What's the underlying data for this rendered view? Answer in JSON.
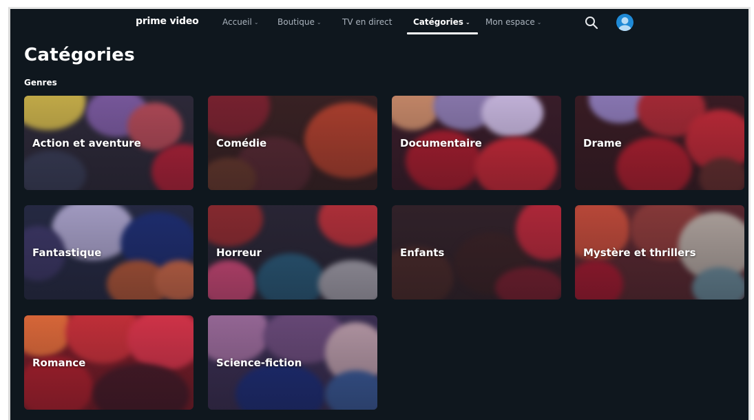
{
  "nav": {
    "brand": "prime video",
    "items": [
      {
        "label": "Accueil",
        "chevron": true,
        "active": false
      },
      {
        "label": "Boutique",
        "chevron": true,
        "active": false
      },
      {
        "label": "TV en direct",
        "chevron": false,
        "active": false
      },
      {
        "label": "Catégories",
        "chevron": true,
        "active": true
      },
      {
        "label": "Mon espace",
        "chevron": true,
        "active": false
      }
    ],
    "icons": [
      "search-icon",
      "avatar"
    ],
    "chevron_glyph": "⌄"
  },
  "page": {
    "title": "Catégories",
    "section": "Genres"
  },
  "genres": [
    {
      "label": "Action et aventure"
    },
    {
      "label": "Comédie"
    },
    {
      "label": "Documentaire"
    },
    {
      "label": "Drame"
    },
    {
      "label": "Fantastique"
    },
    {
      "label": "Horreur"
    },
    {
      "label": "Enfants"
    },
    {
      "label": "Mystère et thrillers"
    },
    {
      "label": "Romance"
    },
    {
      "label": "Science-fiction"
    }
  ],
  "colors": {
    "background": "#0f171e",
    "accent": "#1f8ad6"
  }
}
